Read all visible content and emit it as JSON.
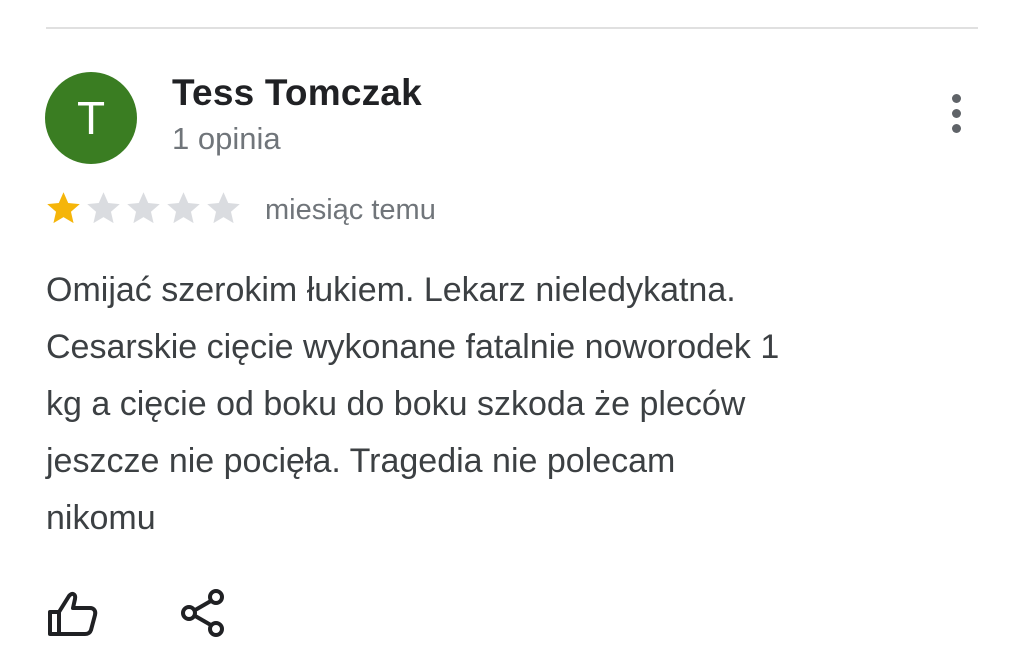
{
  "review": {
    "author": {
      "name": "Tess Tomczak",
      "initial": "T",
      "avatar_color": "#3a7d22",
      "review_count_label": "1 opinia"
    },
    "rating": {
      "value": 1,
      "max": 5,
      "filled_color": "#f5b50a",
      "empty_color": "#dadce0"
    },
    "timestamp": "miesiąc temu",
    "text_lines": [
      "Omijać szerokim łukiem. Lekarz nieledykatna.",
      "Cesarskie cięcie wykonane fatalnie noworodek 1",
      "kg a cięcie od boku do boku szkoda że pleców",
      "jeszcze nie pocięła. Tragedia nie polecam",
      "nikomu"
    ],
    "icons": {
      "more": "more-vert-icon",
      "like": "thumb-up-icon",
      "share": "share-icon"
    }
  }
}
